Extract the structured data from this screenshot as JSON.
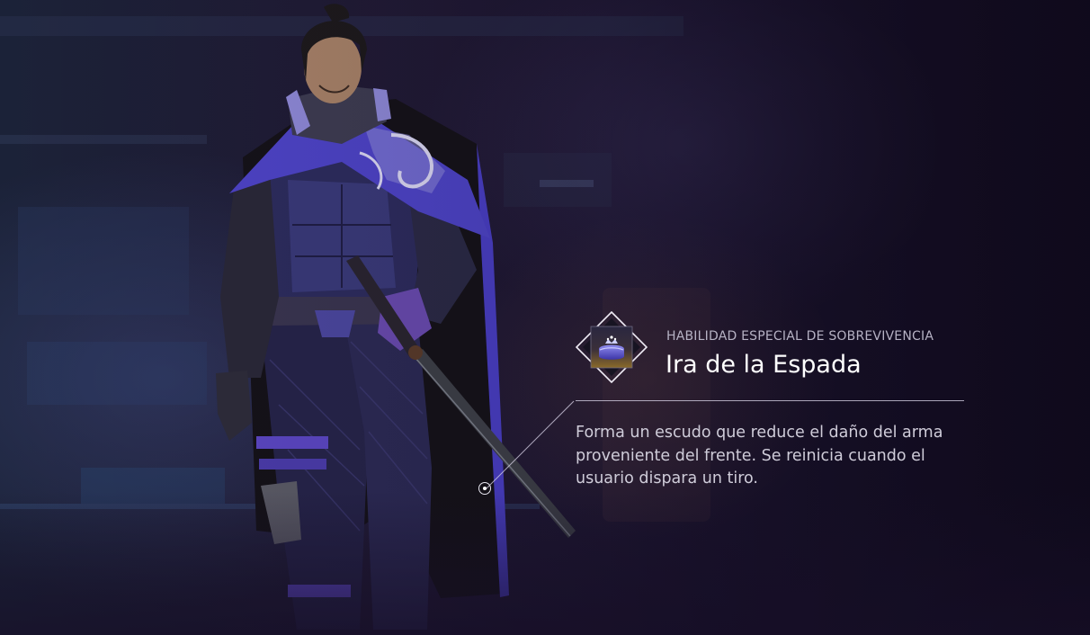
{
  "skill": {
    "category": "HABILIDAD ESPECIAL DE SOBREVIVENCIA",
    "name": "Ira de la Espada",
    "description": "Forma un escudo que reduce el daño del arma proveniente del frente. Se reinicia cuando el usuario dispara un tiro.",
    "icon": "crown-cushion-icon"
  },
  "colors": {
    "accent": "#6a5cd6",
    "badge_gold": "#caa24a",
    "text_primary": "#ffffff",
    "text_secondary": "#cfccd9"
  }
}
